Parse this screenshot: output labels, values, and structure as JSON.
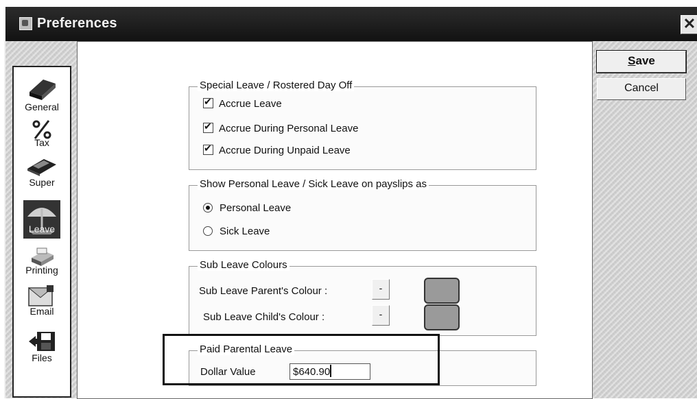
{
  "window": {
    "title": "Preferences",
    "close_symbol": "✕"
  },
  "nav": {
    "items": [
      {
        "label": "General",
        "icon": "book-icon"
      },
      {
        "label": "Tax",
        "icon": "percent-icon"
      },
      {
        "label": "Super",
        "icon": "money-icon"
      },
      {
        "label": "Leave",
        "icon": "umbrella-icon",
        "active": true
      },
      {
        "label": "Printing",
        "icon": "printer-icon"
      },
      {
        "label": "Email",
        "icon": "email-icon"
      },
      {
        "label": "Files",
        "icon": "floppy-disk-icon"
      }
    ]
  },
  "special_leave": {
    "title": "Special Leave / Rostered Day Off",
    "accrue_leave": "Accrue Leave",
    "accrue_personal": "Accrue During Personal Leave",
    "accrue_unpaid": "Accrue During Unpaid Leave"
  },
  "show_leave": {
    "title": "Show Personal Leave / Sick Leave on payslips as",
    "personal": "Personal Leave",
    "sick": "Sick Leave"
  },
  "sub_leave": {
    "title": "Sub Leave Colours",
    "parent_label": "Sub Leave Parent's Colour :",
    "child_label": "Sub Leave Child's Colour :",
    "button_label": "-"
  },
  "paid_parental": {
    "title": "Paid Parental Leave",
    "dollar_label": "Dollar Value",
    "dollar_value": "$640.90"
  },
  "buttons": {
    "save_rest": "ave",
    "save_access": "S",
    "cancel": "Cancel"
  },
  "colors": {
    "titlebar": "#1e1e1e",
    "swatch": "#9a9a9a",
    "dialog_bg": "#d6d6d6"
  }
}
